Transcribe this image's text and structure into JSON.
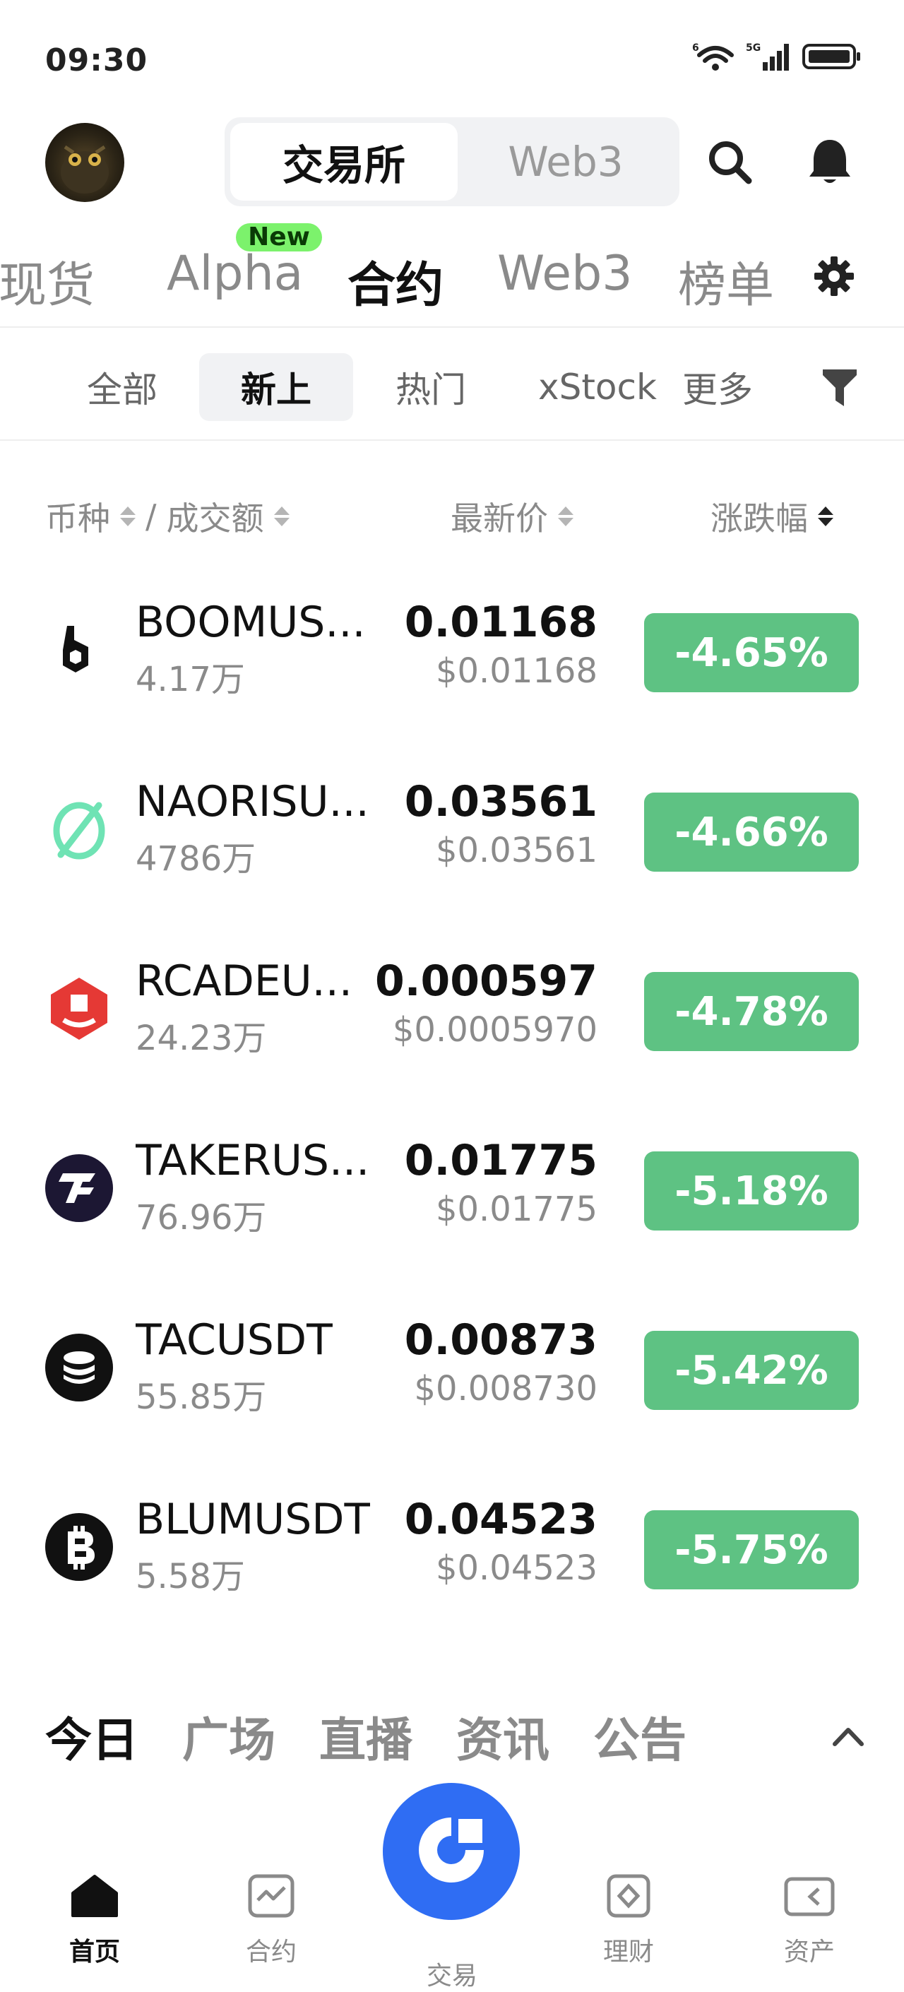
{
  "status_bar": {
    "time": "09:30",
    "wifi_badge": "6",
    "network": "5G"
  },
  "header": {
    "segment": {
      "active": "交易所",
      "inactive": "Web3"
    },
    "icons": [
      "search-icon",
      "bell-icon"
    ]
  },
  "market_tabs": {
    "items": [
      "现货",
      "Alpha",
      "合约",
      "Web3",
      "榜单"
    ],
    "active": "合约",
    "new_badge": "New"
  },
  "sub_tabs": {
    "items": [
      "全部",
      "新上",
      "热门",
      "xStock",
      "更多"
    ],
    "active": "新上"
  },
  "columns": {
    "coin": "币种",
    "separator": "/",
    "volume": "成交额",
    "price": "最新价",
    "change": "涨跌幅"
  },
  "rows": [
    {
      "symbol": "BOOMUS...",
      "volume": "4.17万",
      "price": "0.01168",
      "usd": "$0.01168",
      "change": "-4.65%"
    },
    {
      "symbol": "NAORISU...",
      "volume": "4786万",
      "price": "0.03561",
      "usd": "$0.03561",
      "change": "-4.66%"
    },
    {
      "symbol": "RCADEU...",
      "volume": "24.23万",
      "price": "0.000597",
      "usd": "$0.0005970",
      "change": "-4.78%"
    },
    {
      "symbol": "TAKERUS...",
      "volume": "76.96万",
      "price": "0.01775",
      "usd": "$0.01775",
      "change": "-5.18%"
    },
    {
      "symbol": "TACUSDT",
      "volume": "55.85万",
      "price": "0.00873",
      "usd": "$0.008730",
      "change": "-5.42%"
    },
    {
      "symbol": "BLUMUSDT",
      "volume": "5.58万",
      "price": "0.04523",
      "usd": "$0.04523",
      "change": "-5.75%"
    }
  ],
  "news_tabs": {
    "items": [
      "今日",
      "广场",
      "直播",
      "资讯",
      "公告"
    ],
    "active": "今日"
  },
  "bottom_nav": {
    "items": [
      {
        "label": "首页",
        "icon": "home-icon"
      },
      {
        "label": "合约",
        "icon": "futures-icon"
      },
      {
        "label": "交易",
        "icon": "trade-icon"
      },
      {
        "label": "理财",
        "icon": "finance-icon"
      },
      {
        "label": "资产",
        "icon": "assets-icon"
      }
    ],
    "active": "首页"
  },
  "colors": {
    "up_down_badge": "#5ec283",
    "accent": "#2f6df3",
    "new_badge": "#7cf26c"
  }
}
